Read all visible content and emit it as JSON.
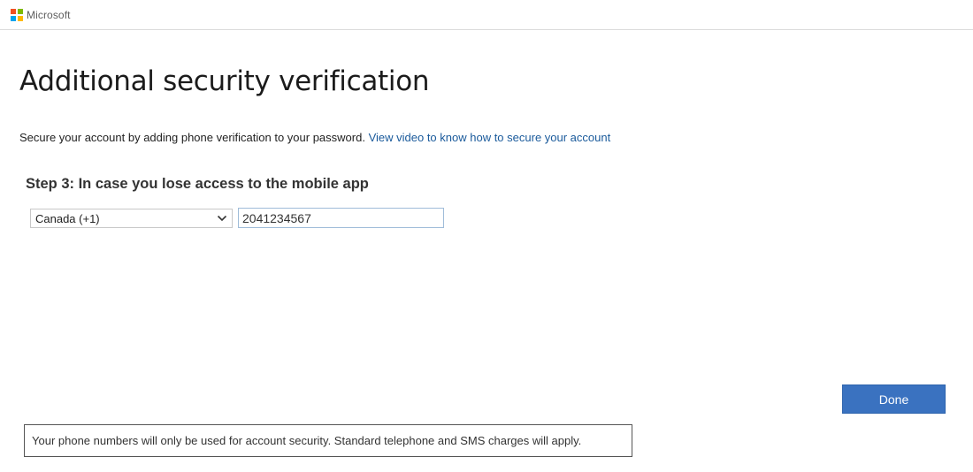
{
  "header": {
    "brand_name": "Microsoft",
    "logo_colors": [
      "#f25022",
      "#7fba00",
      "#00a4ef",
      "#ffb900"
    ]
  },
  "page": {
    "title": "Additional security verification",
    "intro_text": "Secure your account by adding phone verification to your password. ",
    "intro_link": "View video to know how to secure your account",
    "link_color": "#1a5a9b"
  },
  "step": {
    "heading": "Step 3: In case you lose access to the mobile app",
    "country_select": {
      "selected_value": "Canada (+1)",
      "icon": "chevron-down-icon"
    },
    "phone_input": {
      "value": "2041234567",
      "placeholder": ""
    }
  },
  "actions": {
    "done_label": "Done",
    "done_color": "#3a72c0"
  },
  "footer": {
    "notice": "Your phone numbers will only be used for account security. Standard telephone and SMS charges will apply."
  }
}
